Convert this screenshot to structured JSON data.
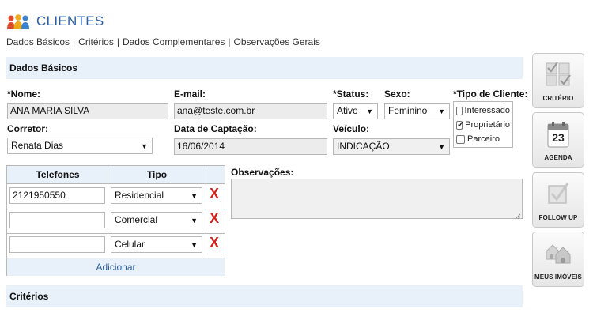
{
  "header": {
    "title": "CLIENTES"
  },
  "nav": {
    "items": [
      "Dados Básicos",
      "Critérios",
      "Dados Complementares",
      "Observações Gerais"
    ],
    "separator": "|"
  },
  "sections": {
    "dados_basicos": "Dados Básicos",
    "criterios": "Critérios"
  },
  "form": {
    "nome": {
      "label": "*Nome:",
      "value": "ANA MARIA SILVA"
    },
    "email": {
      "label": "E-mail:",
      "value": "ana@teste.com.br"
    },
    "status": {
      "label": "*Status:",
      "value": "Ativo"
    },
    "sexo": {
      "label": "Sexo:",
      "value": "Feminino"
    },
    "tipo_cliente": {
      "label": "*Tipo de Cliente:",
      "options": [
        {
          "label": "Interessado",
          "checked": false
        },
        {
          "label": "Proprietário",
          "checked": true
        },
        {
          "label": "Parceiro",
          "checked": false
        }
      ]
    },
    "corretor": {
      "label": "Corretor:",
      "value": "Renata Dias"
    },
    "data_captacao": {
      "label": "Data de Captação:",
      "value": "16/06/2014"
    },
    "veiculo": {
      "label": "Veículo:",
      "value": "INDICAÇÃO"
    },
    "observacoes": {
      "label": "Observações:",
      "value": ""
    }
  },
  "telefones": {
    "headers": {
      "telefone": "Telefones",
      "tipo": "Tipo"
    },
    "rows": [
      {
        "numero": "2121950550",
        "tipo": "Residencial"
      },
      {
        "numero": "",
        "tipo": "Comercial"
      },
      {
        "numero": "",
        "tipo": "Celular"
      }
    ],
    "delete_glyph": "X",
    "add_label": "Adicionar"
  },
  "sidebar": {
    "buttons": [
      {
        "label": "CRITÉRIO",
        "icon": "checklist-icon"
      },
      {
        "label": "AGENDA",
        "icon": "calendar-icon",
        "day": "23"
      },
      {
        "label": "FOLLOW UP",
        "icon": "checkbox-icon"
      },
      {
        "label": "MEUS IMÓVEIS",
        "icon": "houses-icon"
      }
    ]
  },
  "colors": {
    "accent": "#2a5fa8",
    "section_bg": "#e8f0fa",
    "delete": "#d0201a"
  }
}
